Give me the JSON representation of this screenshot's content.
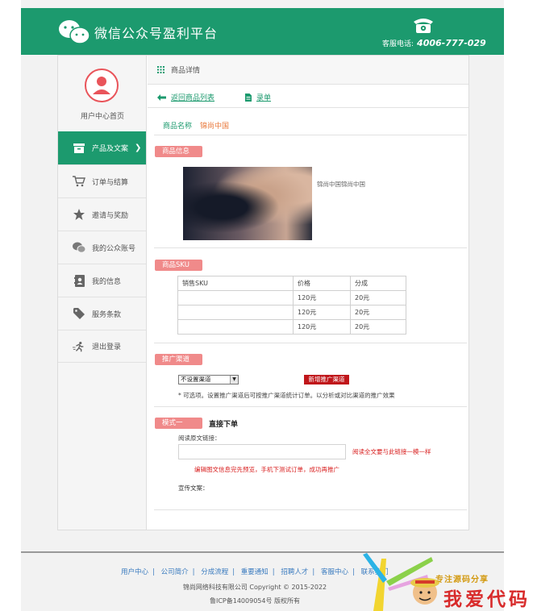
{
  "header": {
    "title": "微信公众号盈利平台",
    "hotline_label": "客服电话:",
    "hotline_number": "4006-777-029"
  },
  "sidebar": {
    "user_center": "用户中心首页",
    "items": [
      {
        "label": "产品及文案",
        "icon": "box-icon",
        "active": true
      },
      {
        "label": "订单与结算",
        "icon": "cart-icon",
        "active": false
      },
      {
        "label": "邀请与奖励",
        "icon": "star-icon",
        "active": false
      },
      {
        "label": "我的公众账号",
        "icon": "wechat-icon",
        "active": false
      },
      {
        "label": "我的信息",
        "icon": "contact-card-icon",
        "active": false
      },
      {
        "label": "服务条款",
        "icon": "tag-icon",
        "active": false
      },
      {
        "label": "退出登录",
        "icon": "run-icon",
        "active": false
      }
    ]
  },
  "breadcrumb": "商品详情",
  "actions": {
    "back": "返回商品列表",
    "record": "录单"
  },
  "product": {
    "name_label": "商品名称",
    "name_value": "锦尚中国"
  },
  "sections": {
    "info": "商品信息",
    "sku": "商品SKU",
    "channel": "推广渠道",
    "mode": "模式一"
  },
  "thumb_caption": "锦尚中国锦尚中国",
  "sku_table": {
    "headers": [
      "销售SKU",
      "价格",
      "分成"
    ],
    "rows": [
      [
        "",
        "120元",
        "20元"
      ],
      [
        "",
        "120元",
        "20元"
      ],
      [
        "",
        "120元",
        "20元"
      ]
    ]
  },
  "channel": {
    "select_value": "不设置渠道",
    "new_button": "新增推广渠道",
    "hint": "* 可选项。设置推广渠道后可按推广渠道统计订单。以分析或对比渠道的推广效果"
  },
  "mode": {
    "title": "直接下单",
    "read_label": "阅读原文链接：",
    "url_value": "",
    "url_note": "阅读全文要与此链接一模一样",
    "warning": "编辑图文信息完先预览，手机下测试订单，成功再推广",
    "promo_label": "宣传文案："
  },
  "footer": {
    "links": [
      "用户中心",
      "公司简介",
      "分成流程",
      "重要通知",
      "招聘人才",
      "客服中心",
      "联系我们"
    ],
    "company": "锦尚网络科技有限公司 Copyright © 2015-2022",
    "icp": "鲁ICP备14009054号 版权所有"
  },
  "watermark": {
    "tagline": "专注源码分享",
    "brand": "我爱代码"
  },
  "colors": {
    "brand_green": "#1c9a6e",
    "badge_pink": "#f08a8a",
    "accent_orange": "#e97a3d",
    "alert_red": "#d81e1e"
  }
}
